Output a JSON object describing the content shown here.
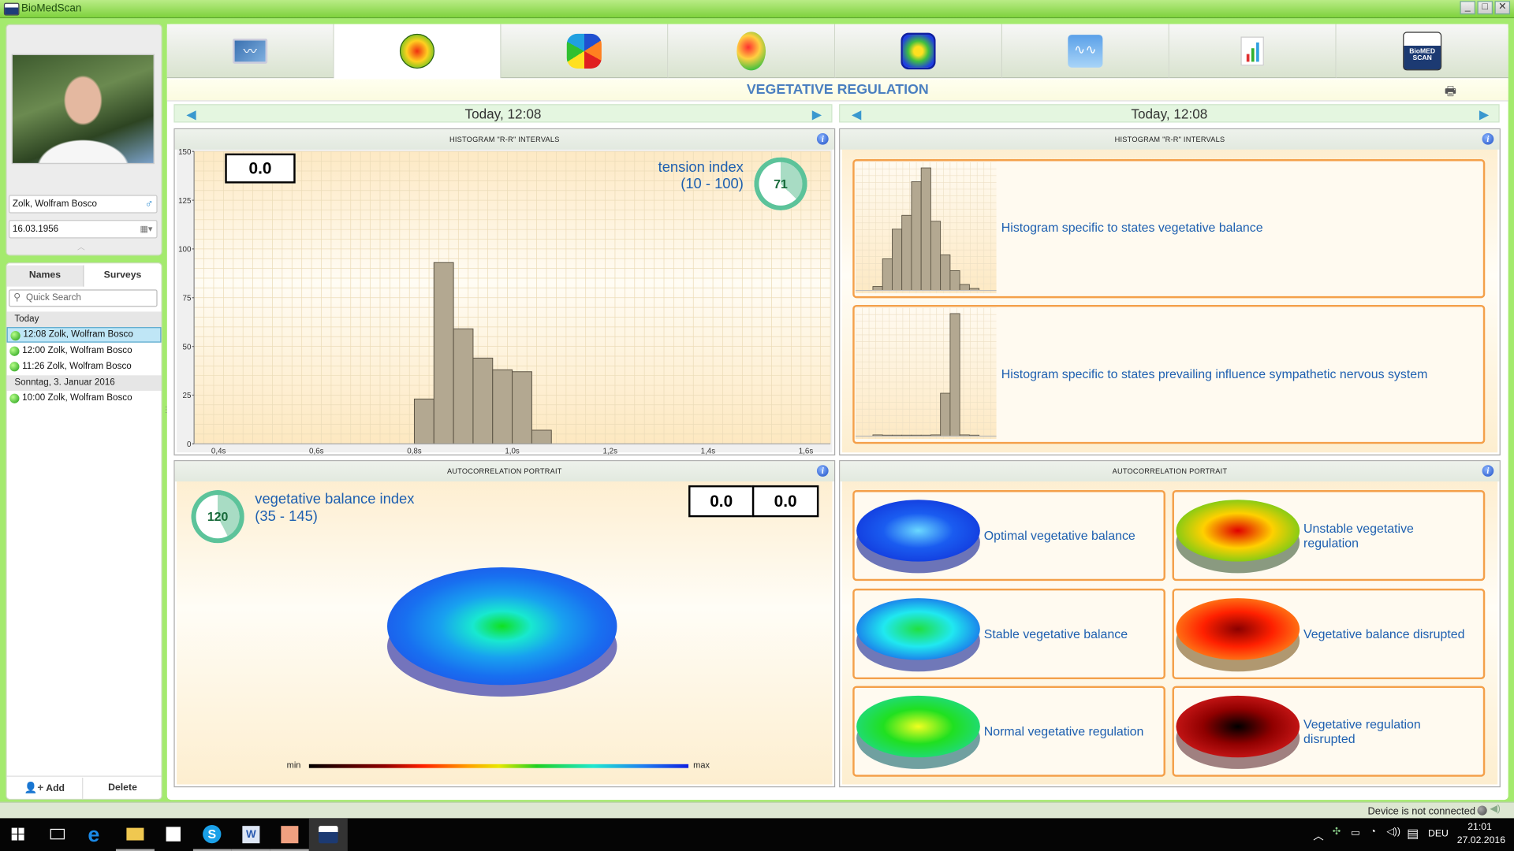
{
  "window": {
    "title": "BioMedScan"
  },
  "patient": {
    "name": "Zolk, Wolfram Bosco",
    "birthdate": "16.03.1956",
    "gender_icon": "male-icon"
  },
  "sidebar": {
    "tabs": [
      {
        "label": "Names"
      },
      {
        "label": "Surveys"
      }
    ],
    "search_placeholder": "Quick Search",
    "groups": [
      {
        "label": "Today",
        "items": [
          {
            "label": "12:08 Zolk, Wolfram Bosco",
            "selected": true
          },
          {
            "label": "12:00 Zolk, Wolfram Bosco"
          },
          {
            "label": "11:26 Zolk, Wolfram Bosco"
          }
        ]
      },
      {
        "label": "Sonntag, 3. Januar 2016",
        "items": [
          {
            "label": "10:00 Zolk, Wolfram Bosco"
          }
        ]
      }
    ],
    "add_label": "Add",
    "delete_label": "Delete"
  },
  "toolbar": {
    "tools": [
      "ecg-monitor-icon",
      "vegetative-regulation-icon",
      "hexagon-cells-icon",
      "brain-map-icon",
      "energy-map-icon",
      "rhythm-graph-icon",
      "bar-chart-icon",
      "biomedscan-logo-icon"
    ],
    "active": 1
  },
  "page": {
    "title": "VEGETATIVE REGULATION"
  },
  "left": {
    "date": "Today, 12:08",
    "histogram": {
      "header": "HISTOGRAM \"R-R\" INTERVALS",
      "value_box": "0.0",
      "index_label": "tension index",
      "index_range": "(10 - 100)",
      "index_value": 71
    },
    "portrait": {
      "header": "AUTOCORRELATION PORTRAIT",
      "index_label": "vegetative balance index",
      "index_range": "(35 - 145)",
      "index_value": 120,
      "value_box_1": "0.0",
      "value_box_2": "0.0",
      "scale_min": "min",
      "scale_max": "max"
    }
  },
  "right": {
    "date": "Today, 12:08",
    "histogram_header": "HISTOGRAM \"R-R\" INTERVALS",
    "histogram_refs": [
      {
        "label": "Histogram specific to states vegetative balance",
        "values": [
          2,
          16,
          31,
          38,
          55,
          62,
          35,
          18,
          10,
          3,
          1
        ]
      },
      {
        "label": "Histogram specific to states prevailing influence sympathetic nervous system",
        "values": [
          1,
          0,
          0,
          0,
          0,
          0,
          1,
          35,
          100,
          1,
          0
        ]
      }
    ],
    "portrait_header": "AUTOCORRELATION PORTRAIT",
    "states": [
      {
        "label": "Optimal vegetative balance",
        "colors": [
          "#6ad8ff",
          "#1a5cf0",
          "#1030d8"
        ],
        "side": "#6c74b8"
      },
      {
        "label": "Unstable vegetative regulation",
        "colors": [
          "#e00000",
          "#ffd000",
          "#40c820"
        ],
        "side": "#8a9a80"
      },
      {
        "label": "Stable vegetative balance",
        "colors": [
          "#20e040",
          "#20e8f0",
          "#1848e8"
        ],
        "side": "#7078b8"
      },
      {
        "label": "Vegetative balance disrupted",
        "colors": [
          "#8a0000",
          "#ff2000",
          "#ffa020"
        ],
        "side": "#b09870"
      },
      {
        "label": "Normal vegetative regulation",
        "colors": [
          "#f0ff20",
          "#20e020",
          "#20d8a0"
        ],
        "side": "#70a0a0"
      },
      {
        "label": "Vegetative regulation disrupted",
        "colors": [
          "#000000",
          "#900000",
          "#e02020"
        ],
        "side": "#a08080"
      }
    ]
  },
  "status": {
    "text": "Device is not connected"
  },
  "taskbar": {
    "lang": "DEU",
    "time": "21:01",
    "date": "27.02.2016"
  },
  "chart_data": {
    "type": "bar",
    "title": "HISTOGRAM \"R-R\" INTERVALS",
    "bin_width": 0.04,
    "bins": [
      0.8,
      0.84,
      0.88,
      0.92,
      0.96,
      1.0,
      1.04
    ],
    "values": [
      23,
      93,
      59,
      44,
      38,
      37,
      7
    ],
    "xlim": [
      0.35,
      1.65
    ],
    "ylim": [
      0,
      150
    ],
    "xticks": [
      0.4,
      0.6,
      0.8,
      1.0,
      1.2,
      1.4,
      1.6
    ],
    "xtick_labels": [
      "0,4s",
      "0,6s",
      "0,8s",
      "1,0s",
      "1,2s",
      "1,4s",
      "1,6s"
    ],
    "yticks": [
      0,
      25,
      50,
      75,
      100,
      125,
      150
    ],
    "grid": true,
    "bar_color": "#b3a891"
  }
}
